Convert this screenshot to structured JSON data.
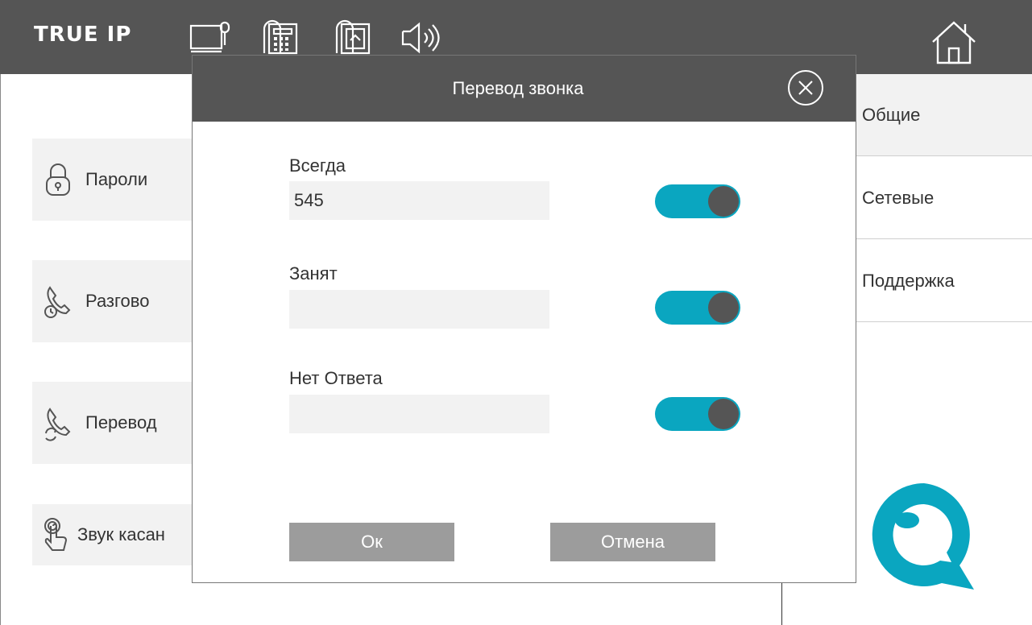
{
  "topbar": {
    "brand": "TRUE IP",
    "icons": [
      "monitor-key-icon",
      "calculator-icon",
      "sim-card-icon",
      "speaker-icon"
    ],
    "home_icon": "home-icon"
  },
  "left_menu": {
    "items": [
      {
        "label": "Пароли",
        "icon": "lock-icon"
      },
      {
        "label": "Разгово",
        "icon": "phone-clock-icon"
      },
      {
        "label": "Перевод",
        "icon": "phone-forward-icon"
      },
      {
        "label": "Звук касан",
        "icon": "touch-icon"
      }
    ]
  },
  "sidebar": {
    "items": [
      {
        "label": "Общие",
        "active": true
      },
      {
        "label": "Сетевые",
        "active": false
      },
      {
        "label": "Поддержка",
        "active": false
      }
    ]
  },
  "dialog": {
    "title": "Перевод звонка",
    "fields": [
      {
        "label": "Всегда",
        "value": "545",
        "enabled": true
      },
      {
        "label": "Занят",
        "value": "",
        "enabled": true
      },
      {
        "label": "Нет Ответа",
        "value": "",
        "enabled": true
      }
    ],
    "ok_label": "Ок",
    "cancel_label": "Отмена"
  },
  "colors": {
    "header": "#555555",
    "accent": "#0aa6c0",
    "panel": "#f2f2f2",
    "button": "#9c9c9c"
  }
}
